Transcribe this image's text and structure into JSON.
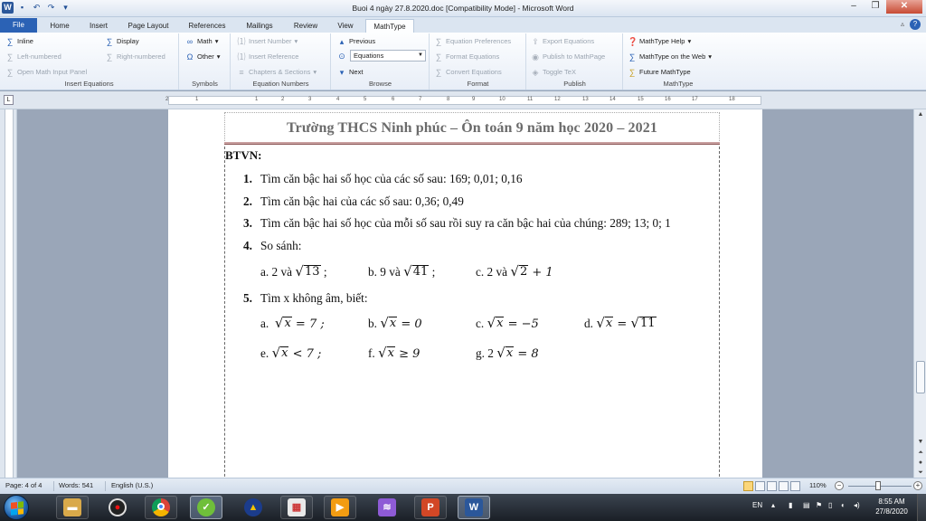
{
  "window": {
    "title": "Buoi 4 ngày 27.8.2020.doc [Compatibility Mode] - Microsoft Word"
  },
  "ribbon": {
    "tabs": [
      "File",
      "Home",
      "Insert",
      "Page Layout",
      "References",
      "Mailings",
      "Review",
      "View",
      "MathType"
    ],
    "groups": {
      "insert_equations": {
        "title": "Insert Equations",
        "inline": "Inline",
        "display": "Display",
        "left_numbered": "Left-numbered",
        "right_numbered": "Right-numbered",
        "open_math_input_panel": "Open Math Input Panel"
      },
      "symbols": {
        "title": "Symbols",
        "math": "Math",
        "other": "Other"
      },
      "equation_numbers": {
        "title": "Equation Numbers",
        "insert_number": "Insert Number",
        "insert_reference": "Insert Reference",
        "chapters_sections": "Chapters & Sections"
      },
      "browse": {
        "title": "Browse",
        "previous": "Previous",
        "dropdown_value": "Equations",
        "next": "Next"
      },
      "format": {
        "title": "Format",
        "equation_preferences": "Equation Preferences",
        "format_equations": "Format Equations",
        "convert_equations": "Convert Equations"
      },
      "publish": {
        "title": "Publish",
        "export_equations": "Export Equations",
        "publish_to_mathpage": "Publish to MathPage",
        "toggle_tex": "Toggle TeX"
      },
      "mathtype": {
        "title": "MathType",
        "help": "MathType Help",
        "on_the_web": "MathType on the Web",
        "future": "Future MathType"
      }
    }
  },
  "ruler": {
    "ticks": [
      "2",
      "1",
      "1",
      "2",
      "3",
      "4",
      "5",
      "6",
      "7",
      "8",
      "9",
      "10",
      "11",
      "12",
      "13",
      "14",
      "15",
      "16",
      "17",
      "18"
    ]
  },
  "document": {
    "header": "Trường THCS Ninh phúc – Ôn toán 9 năm học 2020 – 2021",
    "btvn": "BTVN:",
    "items": [
      {
        "num": "1.",
        "text": "Tìm căn bậc hai số học của các số sau: 169;   0,01;   0,16"
      },
      {
        "num": "2.",
        "text": "Tìm căn bậc hai của các số sau: 0,36;    0,49"
      },
      {
        "num": "3.",
        "text": "Tìm căn bậc hai số học của mỗi số sau rồi suy ra căn bậc hai của chúng: 289; 13; 0; 1"
      },
      {
        "num": "4.",
        "text": "So sánh:"
      },
      {
        "num": "5.",
        "text": "Tìm x không âm, biết:"
      }
    ],
    "compare": {
      "a_prefix": "a.   2 và",
      "a_rad": "13",
      "a_suffix": " ;",
      "b_prefix": "b. 9 và",
      "b_rad": "41",
      "b_suffix": " ;",
      "c_prefix": "c. 2 và",
      "c_rad": "2",
      "c_suffix": " + 1"
    },
    "solve": {
      "a_label": "a.",
      "a_rad": "x",
      "a_rest": " = 7 ;",
      "b_label": "b.",
      "b_rad": "x",
      "b_rest": " = 0",
      "c_label": "c.",
      "c_rad": "x",
      "c_rest": " = −5",
      "d_label": "d.",
      "d_rad": "x",
      "d_eq": " = ",
      "d_rad2": "11",
      "e_label": "e.",
      "e_rad": "x",
      "e_rest": " < 7  ;",
      "f_label": "f.",
      "f_rad": "x",
      "f_rest": " ≥ 9",
      "g_label": "g. 2",
      "g_rad": "x",
      "g_rest": "  = 8"
    }
  },
  "status": {
    "page": "Page: 4 of 4",
    "words": "Words: 541",
    "language": "English (U.S.)",
    "zoom": "110%"
  },
  "taskbar": {
    "lang": "EN",
    "time": "8:55 AM",
    "date": "27/8/2020"
  }
}
